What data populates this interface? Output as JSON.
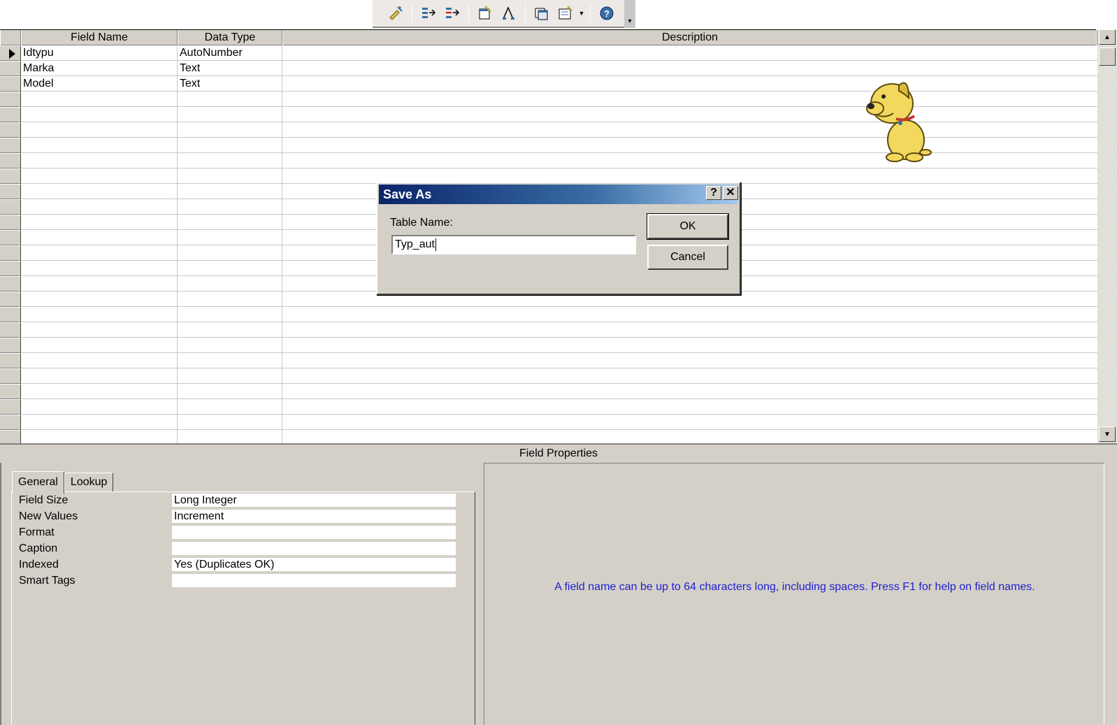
{
  "toolbar": {
    "buttons": [
      "build-icon",
      "insert-rows-icon",
      "delete-rows-icon",
      "properties-icon",
      "indexes-icon",
      "new-object-icon",
      "database-window-icon",
      "help-icon"
    ]
  },
  "grid": {
    "headers": {
      "field_name": "Field Name",
      "data_type": "Data Type",
      "description": "Description"
    },
    "rows": [
      {
        "field_name": "Idtypu",
        "data_type": "AutoNumber",
        "description": ""
      },
      {
        "field_name": "Marka",
        "data_type": "Text",
        "description": ""
      },
      {
        "field_name": "Model",
        "data_type": "Text",
        "description": ""
      }
    ]
  },
  "field_properties": {
    "title": "Field Properties",
    "tabs": [
      "General",
      "Lookup"
    ],
    "properties": [
      {
        "label": "Field Size",
        "value": "Long Integer"
      },
      {
        "label": "New Values",
        "value": "Increment"
      },
      {
        "label": "Format",
        "value": ""
      },
      {
        "label": "Caption",
        "value": ""
      },
      {
        "label": "Indexed",
        "value": "Yes (Duplicates OK)"
      },
      {
        "label": "Smart Tags",
        "value": ""
      }
    ],
    "help_text": "A field name can be up to 64 characters long, including spaces.  Press F1 for help on field names.",
    "help_color": "#1f1fd1"
  },
  "dialog": {
    "title": "Save As",
    "help_button": "?",
    "close_button": "✕",
    "label": "Table Name:",
    "input_value": "Typ_aut",
    "ok": "OK",
    "cancel": "Cancel"
  },
  "scrollbar": {
    "up": "▲",
    "down": "▼"
  }
}
